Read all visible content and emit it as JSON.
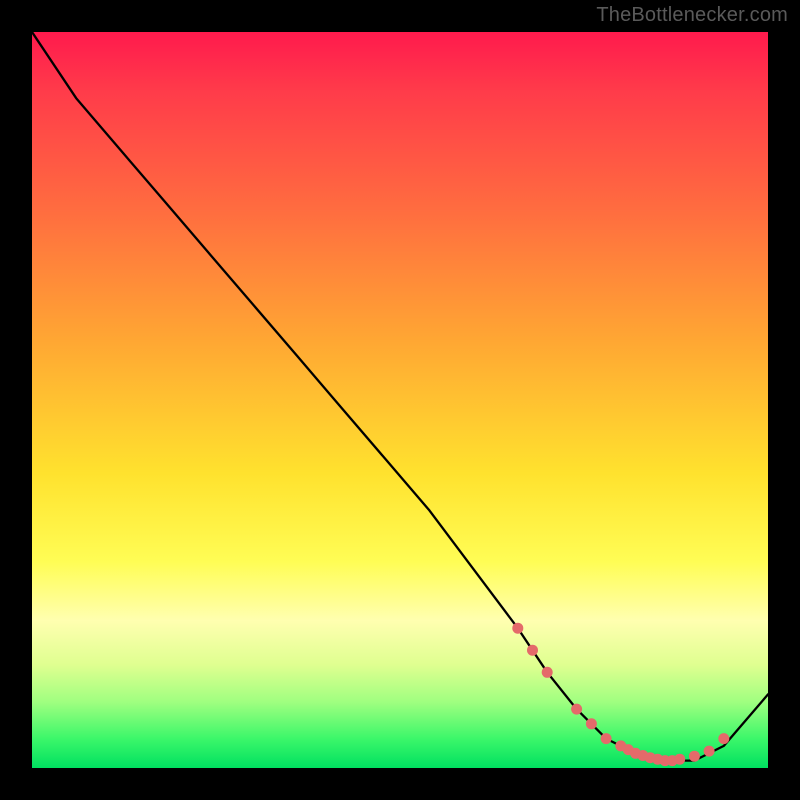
{
  "watermark": "TheBottlenecker.com",
  "chart_data": {
    "type": "line",
    "title": "",
    "xlabel": "",
    "ylabel": "",
    "xlim": [
      0,
      100
    ],
    "ylim": [
      0,
      100
    ],
    "series": [
      {
        "name": "curve",
        "x": [
          0,
          6,
          12,
          18,
          24,
          30,
          36,
          42,
          48,
          54,
          60,
          66,
          70,
          74,
          78,
          82,
          86,
          90,
          94,
          100
        ],
        "y": [
          100,
          91,
          84,
          77,
          70,
          63,
          56,
          49,
          42,
          35,
          27,
          19,
          13,
          8,
          4,
          2,
          1,
          1,
          3,
          10
        ]
      }
    ],
    "markers": {
      "name": "highlight-points",
      "color": "#e46a6a",
      "x": [
        66,
        68,
        70,
        74,
        76,
        78,
        80,
        81,
        82,
        83,
        84,
        85,
        86,
        87,
        88,
        90,
        92,
        94
      ],
      "y": [
        19,
        16,
        13,
        8,
        6,
        4,
        3,
        2.5,
        2,
        1.7,
        1.4,
        1.2,
        1,
        1,
        1.2,
        1.6,
        2.3,
        4
      ]
    },
    "gradient_stops": [
      {
        "pos": 0.0,
        "color": "#ff1a4d"
      },
      {
        "pos": 0.25,
        "color": "#ff6f3f"
      },
      {
        "pos": 0.6,
        "color": "#ffe22e"
      },
      {
        "pos": 0.85,
        "color": "#dfff90"
      },
      {
        "pos": 1.0,
        "color": "#00e060"
      }
    ]
  }
}
